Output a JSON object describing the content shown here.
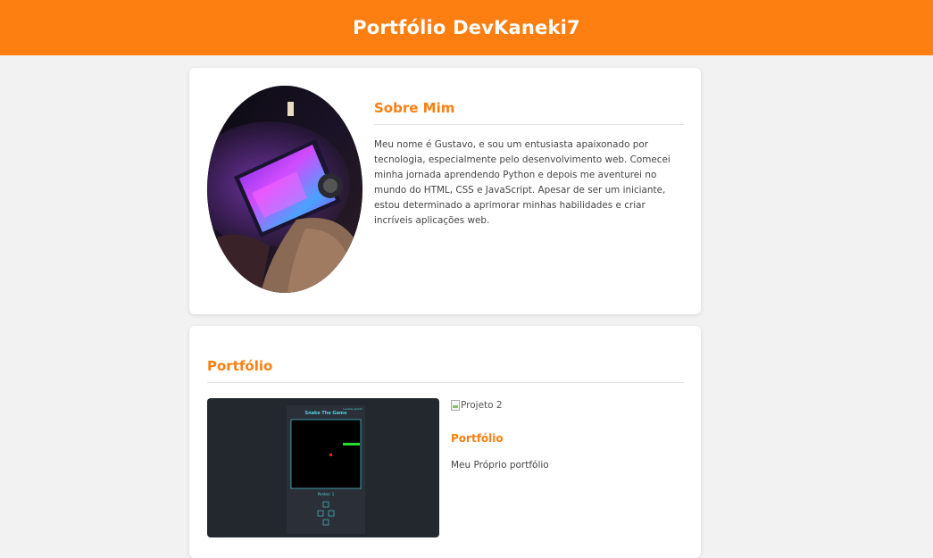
{
  "header": {
    "title": "Portfólio DevKaneki7"
  },
  "about": {
    "heading": "Sobre Mim",
    "text": "Meu nome é Gustavo, e sou um entusiasta apaixonado por tecnologia, especialmente pelo desenvolvimento web. Comecei minha jornada aprendendo Python e depois me aventurei no mundo do HTML, CSS e JavaScript. Apesar de ser um iniciante, estou determinado a aprimorar minhas habilidades e criar incríveis aplicações web.",
    "avatar_icon": "profile-photo"
  },
  "portfolio": {
    "heading": "Portfólio",
    "projects": [
      {
        "thumb_title": "Snake The Game",
        "thumb_corner": "Lucates Jannik",
        "thumb_score": "Pontos: 1"
      },
      {
        "image_alt": "Projeto 2",
        "title": "Portfólio",
        "description": "Meu Próprio portfólio"
      }
    ]
  },
  "colors": {
    "accent": "#fe7f11",
    "background": "#f2f2f2",
    "card": "#ffffff"
  }
}
